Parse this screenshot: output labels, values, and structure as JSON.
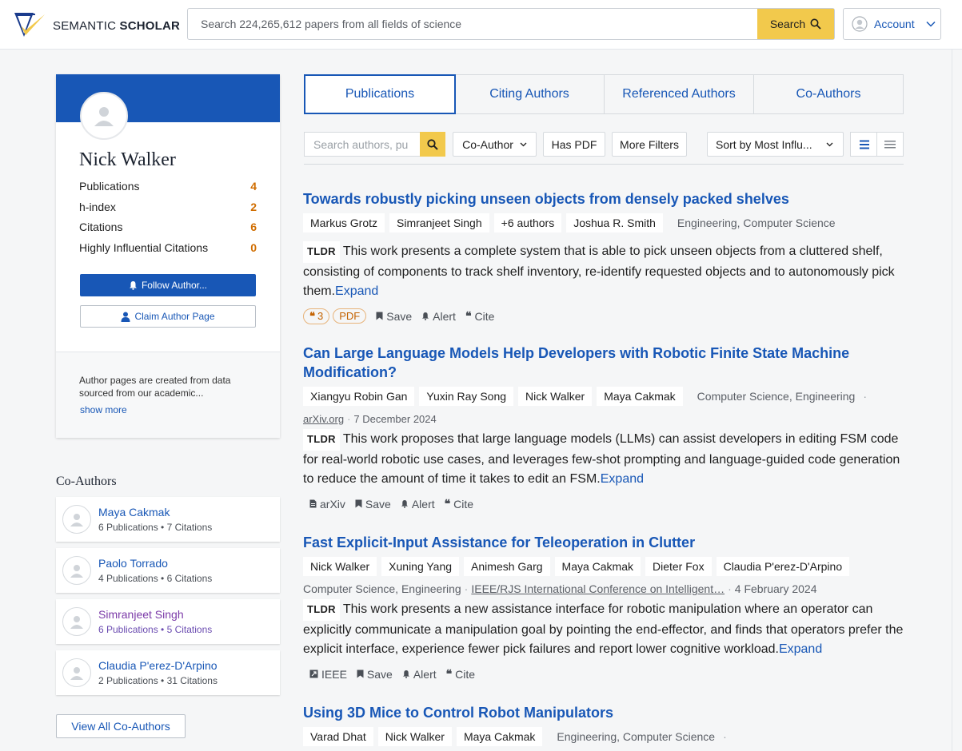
{
  "header": {
    "logo_text_a": "SEMANTIC ",
    "logo_text_b": "SCHOLAR",
    "search_placeholder": "Search 224,265,612 papers from all fields of science",
    "search_button": "Search",
    "account_label": "Account"
  },
  "author": {
    "name": "Nick Walker",
    "stats": [
      {
        "label": "Publications",
        "value": "4"
      },
      {
        "label": "h-index",
        "value": "2"
      },
      {
        "label": "Citations",
        "value": "6"
      },
      {
        "label": "Highly Influential Citations",
        "value": "0"
      }
    ],
    "follow_label": "Follow Author...",
    "claim_label": "Claim Author Page",
    "note": "Author pages are created from data sourced from our academic...",
    "show_more": "show more"
  },
  "coauthors": {
    "heading": "Co-Authors",
    "items": [
      {
        "name": "Maya Cakmak",
        "meta": "6 Publications • 7 Citations"
      },
      {
        "name": "Paolo Torrado",
        "meta": "4 Publications • 6 Citations"
      },
      {
        "name": "Simranjeet Singh",
        "meta": "6 Publications • 5 Citations"
      },
      {
        "name": "Claudia P'erez-D'Arpino",
        "meta": "2 Publications • 31 Citations"
      }
    ],
    "view_all": "View All Co-Authors"
  },
  "tabs": [
    "Publications",
    "Citing Authors",
    "Referenced Authors",
    "Co-Authors"
  ],
  "filters": {
    "search_placeholder": "Search authors, pu",
    "coauthor": "Co-Author",
    "has_pdf": "Has PDF",
    "more_filters": "More Filters",
    "sort": "Sort by Most Influ..."
  },
  "papers": [
    {
      "title": "Towards robustly picking unseen objects from densely packed shelves",
      "authors": [
        "Markus Grotz",
        "Simranjeet Singh",
        "+6 authors",
        "Joshua R. Smith"
      ],
      "fields": "Engineering, Computer Science",
      "tldr_label": "TLDR",
      "abstract": "This work presents a complete system that is able to pick unseen objects from a cluttered shelf, consisting of components to track shelf inventory, re-identify requested objects and to autonomously pick them.",
      "expand": "Expand",
      "citations": "3",
      "pdf": "PDF",
      "save": "Save",
      "alert": "Alert",
      "cite": "Cite"
    },
    {
      "title": "Can Large Language Models Help Developers with Robotic Finite State Machine Modification?",
      "authors": [
        "Xiangyu Robin Gan",
        "Yuxin Ray Song",
        "Nick Walker",
        "Maya Cakmak"
      ],
      "fields": "Computer Science, Engineering",
      "venue": "arXiv.org",
      "date": "7 December 2024",
      "tldr_label": "TLDR",
      "abstract": "This work proposes that large language models (LLMs) can assist developers in editing FSM code for real-world robotic use cases, and leverages few-shot prompting and language-guided code generation to reduce the amount of time it takes to edit an FSM.",
      "expand": "Expand",
      "source": "arXiv",
      "save": "Save",
      "alert": "Alert",
      "cite": "Cite"
    },
    {
      "title": "Fast Explicit-Input Assistance for Teleoperation in Clutter",
      "authors": [
        "Nick Walker",
        "Xuning Yang",
        "Animesh Garg",
        "Maya Cakmak",
        "Dieter Fox",
        "Claudia P'erez-D'Arpino"
      ],
      "fields": "Computer Science, Engineering",
      "venue": "IEEE/RJS International Conference on Intelligent…",
      "date": "4 February 2024",
      "tldr_label": "TLDR",
      "abstract": "This work presents a new assistance interface for robotic manipulation where an operator can explicitly communicate a manipulation goal by pointing the end-effector, and finds that operators prefer the explicit interface, experience fewer pick failures and report lower cognitive workload.",
      "expand": "Expand",
      "source": "IEEE",
      "save": "Save",
      "alert": "Alert",
      "cite": "Cite"
    },
    {
      "title": "Using 3D Mice to Control Robot Manipulators",
      "authors": [
        "Varad Dhat",
        "Nick Walker",
        "Maya Cakmak"
      ],
      "fields": "Engineering, Computer Science"
    }
  ],
  "colors": {
    "accent": "#1857b6",
    "search_yellow": "#f2c94c",
    "stat_orange": "#d06d00"
  }
}
